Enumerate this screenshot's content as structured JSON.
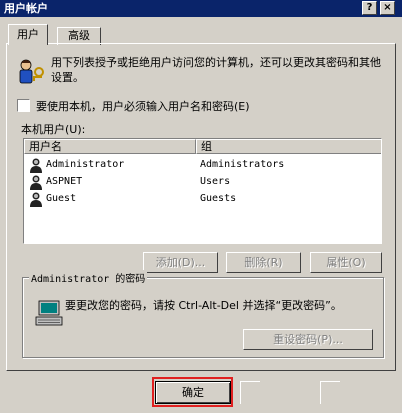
{
  "window": {
    "title": "用户帐户",
    "help_label": "?",
    "close_label": "×"
  },
  "tabs": [
    {
      "label": "用户"
    },
    {
      "label": "高级"
    }
  ],
  "intro": {
    "text": "用下列表授予或拒绝用户访问您的计算机，还可以更改其密码和其他设置。",
    "icon": "users-keys-icon"
  },
  "require_login": {
    "label": "要使用本机，用户必须输入用户名和密码(E)",
    "checked": false
  },
  "users_section": {
    "label": "本机用户(U):",
    "columns": [
      "用户名",
      "组"
    ],
    "rows": [
      {
        "name": "Administrator",
        "group": "Administrators"
      },
      {
        "name": "ASPNET",
        "group": "Users"
      },
      {
        "name": "Guest",
        "group": "Guests"
      }
    ],
    "buttons": {
      "add": "添加(D)...",
      "remove": "删除(R)",
      "properties": "属性(O)"
    }
  },
  "password_group": {
    "legend": "Administrator 的密码",
    "text": "要更改您的密码，请按 Ctrl-Alt-Del 并选择“更改密码”。",
    "reset_button": "重设密码(P)...",
    "icon": "computer-keyboard-icon"
  },
  "footer": {
    "ok_label": "确定"
  }
}
